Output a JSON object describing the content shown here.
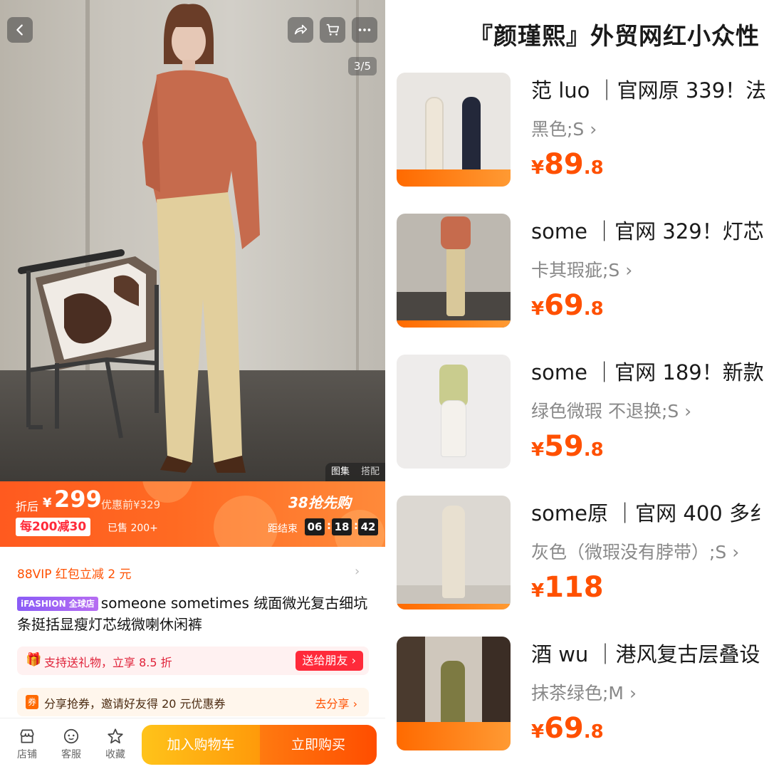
{
  "product": {
    "image_counter": "3/5",
    "gallery_tabs": [
      "图集",
      "搭配"
    ],
    "promo": {
      "price_prefix": "折后",
      "currency": "¥",
      "price": "299",
      "before_price": "优惠前¥329",
      "coupon": "每200减30",
      "sold": "已售 200+",
      "event": "38抢先购",
      "ends_label": "距结束",
      "countdown": [
        "06",
        "18",
        "42"
      ]
    },
    "vip_text": "88VIP 红包立减 2 元",
    "vip_arrow": "›",
    "badge": "iFASHION 全球店",
    "title": "someone sometimes 绒面微光复古细坑条挺括显瘦灯芯绒微喇休闲裤",
    "gift": {
      "icon": "🎁",
      "text": "支持送礼物，立享 8.5 折",
      "button": "送给朋友 ›"
    },
    "share": {
      "icon": "券",
      "text": "分享抢券，邀请好友得 20 元优惠券",
      "button": "去分享 ›"
    },
    "bottom_nav": {
      "shop": "店铺",
      "service": "客服",
      "favorite": "收藏",
      "add_cart": "加入购物车",
      "buy_now": "立即购买"
    }
  },
  "resale": {
    "header": "『颜瑾熙』外贸网红小众性",
    "items": [
      {
        "title": "范 luo ｜官网原 339！法",
        "spec": "黑色;S ›",
        "yen": "¥",
        "int": "89",
        "dec": ".8"
      },
      {
        "title": "some ｜官网 329！灯芯",
        "spec": "卡其瑕疵;S ›",
        "yen": "¥",
        "int": "69",
        "dec": ".8"
      },
      {
        "title": "some ｜官网 189！新款",
        "spec": "绿色微瑕 不退换;S ›",
        "yen": "¥",
        "int": "59",
        "dec": ".8"
      },
      {
        "title": "some原 ｜官网 400 多纟",
        "spec": "灰色（微瑕没有脖带）;S ›",
        "yen": "¥",
        "int": "118",
        "dec": ""
      },
      {
        "title": "酒 wu ｜港风复古层叠设",
        "spec": "抹茶绿色;M ›",
        "yen": "¥",
        "int": "69",
        "dec": ".8"
      }
    ]
  },
  "colors": {
    "accent": "#ff5000",
    "buy": "#ff4d00",
    "cart": "#ffb012",
    "gift_red": "#ff2a3a"
  }
}
